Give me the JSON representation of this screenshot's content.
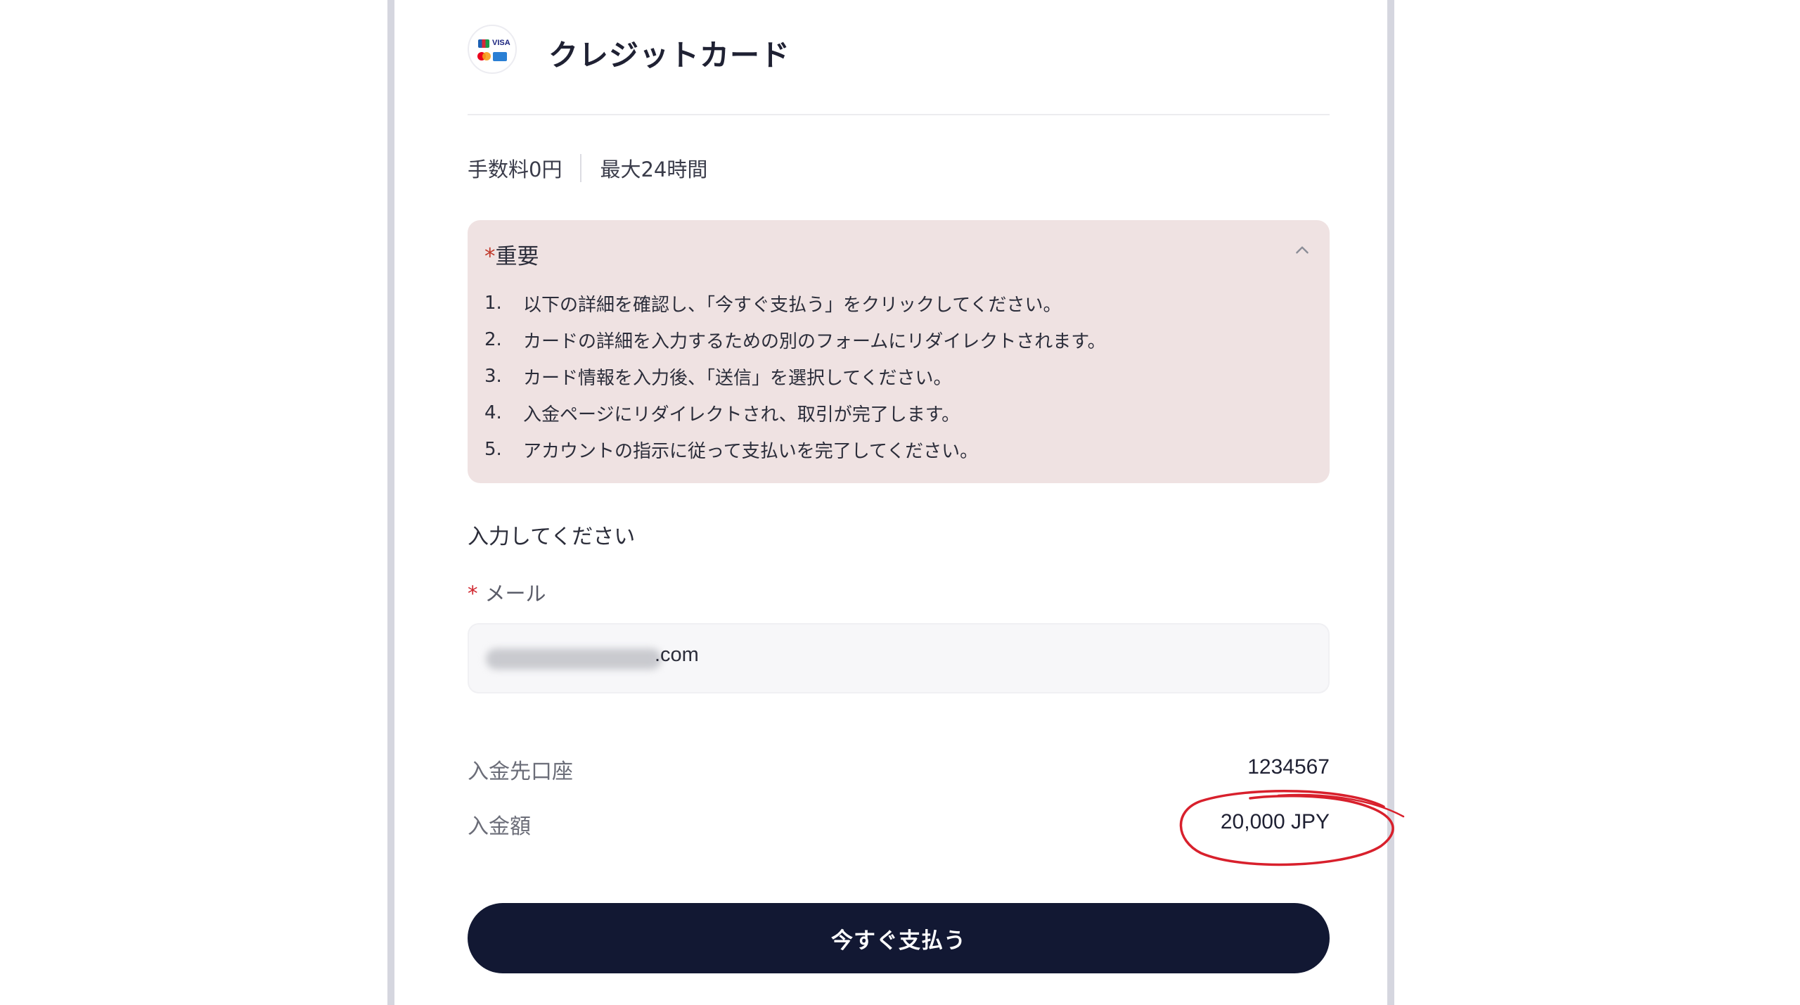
{
  "header": {
    "title": "クレジットカード",
    "logo_icon": "credit-card-brands-icon"
  },
  "meta": {
    "fee": "手数料0円",
    "time": "最大24時間"
  },
  "important": {
    "star": "*",
    "title": "重要",
    "toggle_icon": "chevron-up-icon",
    "steps": [
      {
        "num": "1.",
        "text": "以下の詳細を確認し、「今すぐ支払う」をクリックしてください。"
      },
      {
        "num": "2.",
        "text": "カードの詳細を入力するための別のフォームにリダイレクトされます。"
      },
      {
        "num": "3.",
        "text": "カード情報を入力後、「送信」を選択してください。"
      },
      {
        "num": "4.",
        "text": "入金ページにリダイレクトされ、取引が完了します。"
      },
      {
        "num": "5.",
        "text": "アカウントの指示に従って支払いを完了してください。"
      }
    ]
  },
  "form": {
    "section_label": "入力してください",
    "email_required_mark": "*",
    "email_label": "メール",
    "email_value_suffix": ".com"
  },
  "summary": {
    "account_label": "入金先口座",
    "account_value": "1234567",
    "amount_label": "入金額",
    "amount_value": "20,000 JPY"
  },
  "pay_button": {
    "label": "今すぐ支払う"
  },
  "colors": {
    "button_bg": "#121833",
    "notice_bg": "#efe2e2",
    "annotation": "#d8202c"
  }
}
